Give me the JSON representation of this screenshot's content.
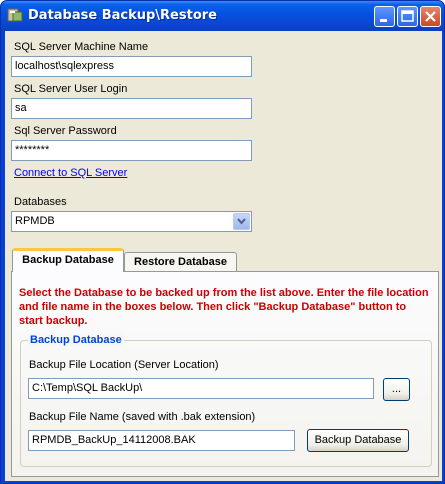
{
  "window": {
    "title": "Database Backup\\Restore"
  },
  "connection": {
    "server_label": "SQL Server Machine Name",
    "server_value": "localhost\\sqlexpress",
    "login_label": "SQL Server User Login",
    "login_value": "sa",
    "password_label": "Sql Server Password",
    "password_value": "********",
    "connect_link": "Connect to SQL Server"
  },
  "databases": {
    "label": "Databases",
    "selected": "RPMDB"
  },
  "tabs": [
    {
      "label": "Backup Database",
      "active": true
    },
    {
      "label": "Restore Database",
      "active": false
    }
  ],
  "backup": {
    "instructions": "Select the Database to be backed up from the list above. Enter the file location and file name in the boxes below. Then click \"Backup Database\" button to start backup.",
    "group_title": "Backup Database",
    "location_label": "Backup File Location (Server Location)",
    "location_value": "C:\\Temp\\SQL BackUp\\",
    "browse_label": "...",
    "filename_label": "Backup File Name (saved with .bak extension)",
    "filename_value": "RPMDB_BackUp_14112008.BAK",
    "backup_button": "Backup Database"
  }
}
